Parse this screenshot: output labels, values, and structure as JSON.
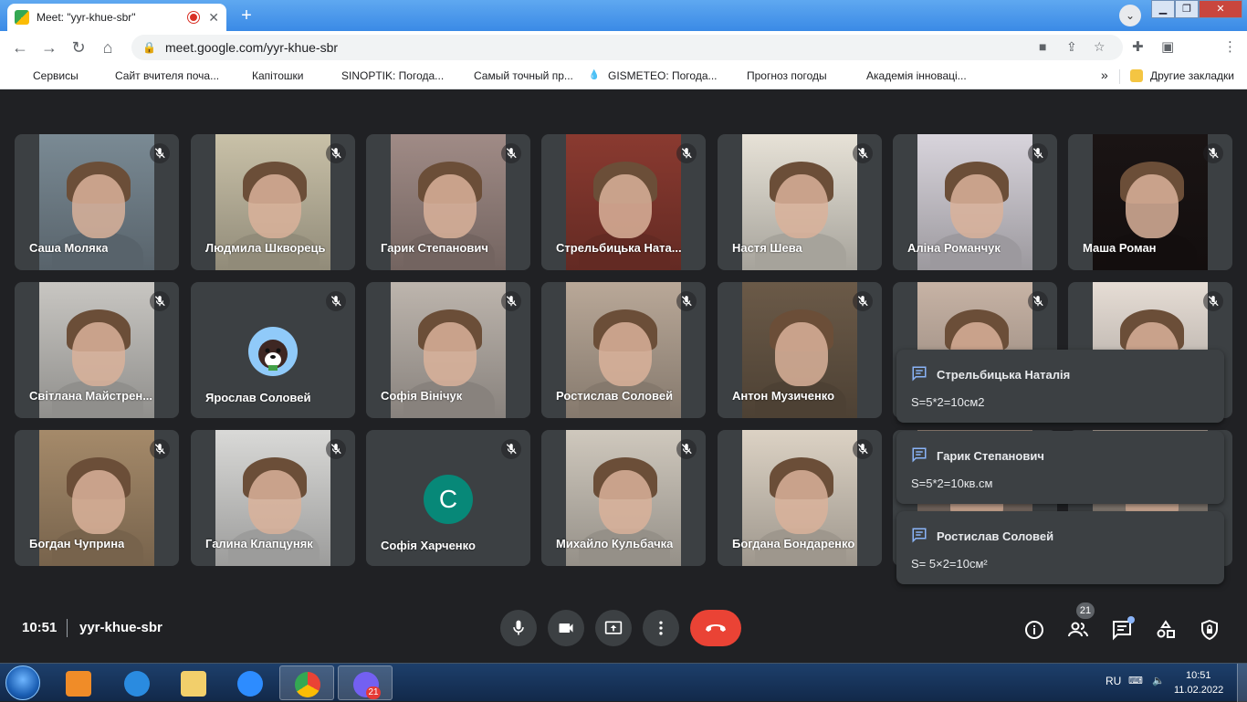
{
  "browser": {
    "tab_title": "Meet: \"yyr-khue-sbr\"",
    "tab_close": "✕",
    "new_tab": "+",
    "url": "meet.google.com/yyr-khue-sbr",
    "bookmarks": [
      {
        "label": "Сервисы",
        "icon": "apps-icon",
        "color": "#4285f4"
      },
      {
        "label": "Сайт вчителя поча...",
        "icon": "globe-icon",
        "color": "#3b6fd0"
      },
      {
        "label": "Капітошки",
        "icon": "blogger-icon",
        "color": "#f57d00"
      },
      {
        "label": "SINOPTIK: Погода...",
        "icon": "thermometer-icon",
        "color": "#d32f2f"
      },
      {
        "label": "Самый точный пр...",
        "icon": "a-letter-icon",
        "color": "#e53935"
      },
      {
        "label": "GISMETEO: Погода...",
        "icon": "drop-icon",
        "color": "#1e88e5"
      },
      {
        "label": "Прогноз погоды",
        "icon": "globe-icon",
        "color": "#555555"
      },
      {
        "label": "Академія інноваці...",
        "icon": "academy-icon",
        "color": "#7cb342"
      }
    ],
    "bookmarks_more": "»",
    "other_bookmarks": "Другие закладки"
  },
  "participants": [
    {
      "name": "Саша Моляка",
      "type": "video",
      "bg": "#7a8a94"
    },
    {
      "name": "Людмила Шкворець",
      "type": "video",
      "bg": "#c9c1a8"
    },
    {
      "name": "Гарик Степанович",
      "type": "video",
      "bg": "#a08b86"
    },
    {
      "name": "Стрельбицька Ната...",
      "type": "video",
      "bg": "#8a3a30"
    },
    {
      "name": "Настя Шева",
      "type": "video",
      "bg": "#e7e2d7"
    },
    {
      "name": "Аліна Романчук",
      "type": "video",
      "bg": "#d8d4dc"
    },
    {
      "name": "Маша Роман",
      "type": "video",
      "bg": "#1a1414"
    },
    {
      "name": "Світлана Майстрен...",
      "type": "video",
      "bg": "#c8c6c2"
    },
    {
      "name": "Ярослав Соловей",
      "type": "avatar"
    },
    {
      "name": "Софія Вінічук",
      "type": "video",
      "bg": "#bdb5ad"
    },
    {
      "name": "Ростислав Соловей",
      "type": "video",
      "bg": "#b9a898"
    },
    {
      "name": "Антон Музиченко",
      "type": "video",
      "bg": "#6b5a48"
    },
    {
      "name": "",
      "type": "video",
      "bg": "#c7b3a5"
    },
    {
      "name": "",
      "type": "video",
      "bg": "#e6ddd5"
    },
    {
      "name": "Богдан Чуприна",
      "type": "video",
      "bg": "#a58a6a"
    },
    {
      "name": "Галина Клапцуняк",
      "type": "video",
      "bg": "#d9d9d7"
    },
    {
      "name": "Софія Харченко",
      "type": "letter",
      "letter": "С"
    },
    {
      "name": "Михайло Кульбачка",
      "type": "video",
      "bg": "#cfc8bd"
    },
    {
      "name": "Богдана Бондаренко",
      "type": "video",
      "bg": "#dcd2c4"
    },
    {
      "name": "",
      "type": "video",
      "bg": "#8a7a70"
    },
    {
      "name": "",
      "type": "video",
      "bg": "#9a8f86"
    }
  ],
  "chat_toasts": [
    {
      "author": "Стрельбицька Наталія",
      "text": "S=5*2=10см2"
    },
    {
      "author": "Гарик Степанович",
      "text": "S=5*2=10кв.см"
    },
    {
      "author": "Ростислав Соловей",
      "text": "S= 5×2=10см²"
    }
  ],
  "meeting": {
    "time": "10:51",
    "code": "yyr-khue-sbr",
    "participants_count": "21"
  },
  "taskbar": {
    "lang": "RU",
    "time": "10:51",
    "date": "11.02.2022",
    "viber_badge": "21"
  },
  "colors": {
    "end_call": "#ea4335",
    "accent": "#8ab4f8",
    "meet_bg": "#202124",
    "tile_bg": "#3c4043",
    "avatar_letter_bg": "#078878"
  }
}
